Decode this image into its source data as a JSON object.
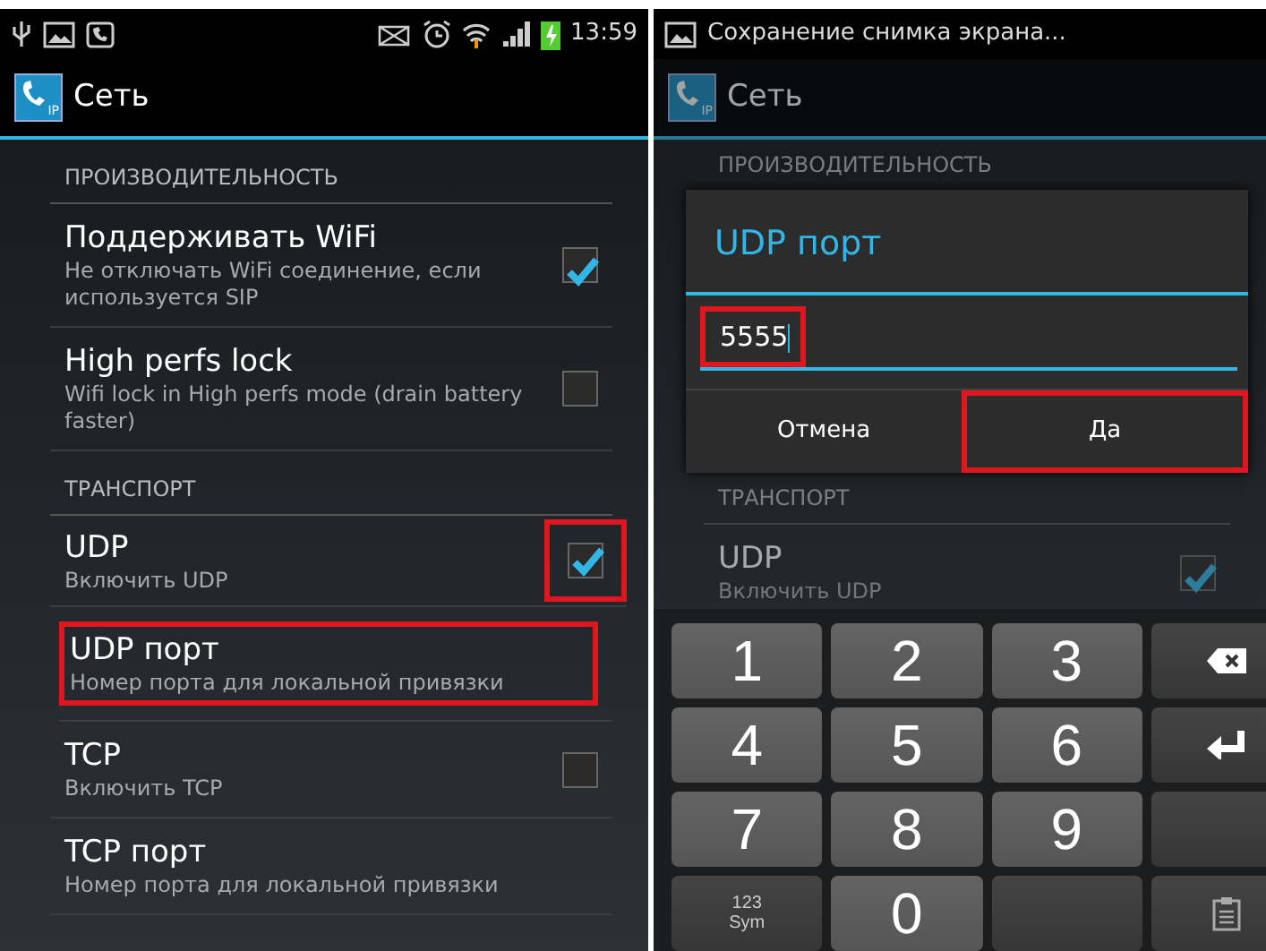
{
  "left_screen": {
    "status_bar": {
      "time": "13:59"
    },
    "action_bar": {
      "icon_text": "IP",
      "title": "Сеть"
    },
    "sections": [
      {
        "header": "ПРОИЗВОДИТЕЛЬНОСТЬ",
        "items": [
          {
            "kind": "checkbox",
            "title": "Поддерживать WiFi",
            "summary": "Не отключать WiFi соединение, если используется SIP",
            "checked": true,
            "highlighted": false,
            "checkbox_highlighted": false
          },
          {
            "kind": "checkbox",
            "title": "High perfs lock",
            "summary": "Wifi lock in High perfs mode (drain battery faster)",
            "checked": false,
            "highlighted": false,
            "checkbox_highlighted": false
          }
        ]
      },
      {
        "header": "ТРАНСПОРТ",
        "items": [
          {
            "kind": "checkbox",
            "title": "UDP",
            "summary": "Включить UDP",
            "checked": true,
            "highlighted": false,
            "checkbox_highlighted": true
          },
          {
            "kind": "text",
            "title": "UDP порт",
            "summary": "Номер порта для локальной привязки",
            "highlighted": true
          },
          {
            "kind": "checkbox",
            "title": "TCP",
            "summary": "Включить TCP",
            "checked": false,
            "highlighted": false,
            "checkbox_highlighted": false
          },
          {
            "kind": "text",
            "title": "TCP порт",
            "summary": "Номер порта для локальной привязки",
            "highlighted": false
          }
        ]
      }
    ]
  },
  "right_screen": {
    "status_bar": {
      "notification": "Сохранение снимка экрана..."
    },
    "action_bar": {
      "icon_text": "IP",
      "title": "Сеть"
    },
    "background": {
      "headers": [
        "ПРОИЗВОДИТЕЛЬНОСТЬ",
        "ТРАНСПОРТ"
      ],
      "item": {
        "title": "UDP",
        "summary": "Включить UDP",
        "checked": true
      }
    },
    "dialog": {
      "title": "UDP порт",
      "value": "5555",
      "value_highlighted": true,
      "buttons": [
        {
          "label": "Отмена",
          "highlighted": false
        },
        {
          "label": "Да",
          "highlighted": true
        }
      ]
    },
    "keyboard": {
      "keys": [
        {
          "kind": "digit",
          "label": "1"
        },
        {
          "kind": "digit",
          "label": "2"
        },
        {
          "kind": "digit",
          "label": "3"
        },
        {
          "kind": "backspace"
        },
        {
          "kind": "digit",
          "label": "4"
        },
        {
          "kind": "digit",
          "label": "5"
        },
        {
          "kind": "digit",
          "label": "6"
        },
        {
          "kind": "enter"
        },
        {
          "kind": "digit",
          "label": "7"
        },
        {
          "kind": "digit",
          "label": "8"
        },
        {
          "kind": "digit",
          "label": "9"
        },
        {
          "kind": "blank"
        },
        {
          "kind": "sym",
          "label": "123",
          "sublabel": "Sym"
        },
        {
          "kind": "digit",
          "label": "0"
        },
        {
          "kind": "blank"
        },
        {
          "kind": "clipboard"
        }
      ]
    }
  }
}
